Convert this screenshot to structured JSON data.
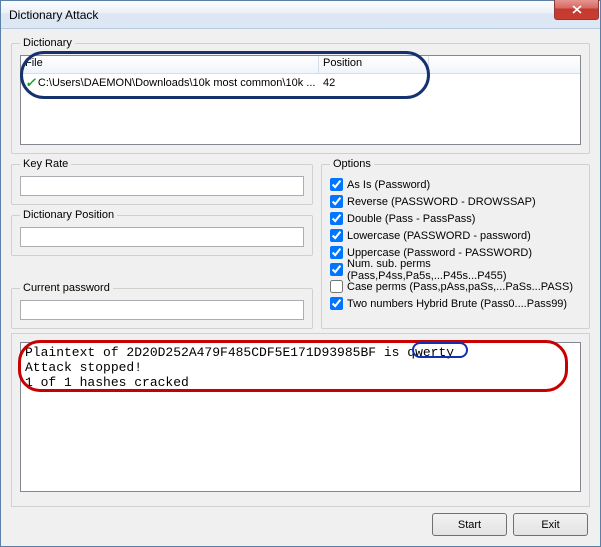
{
  "window": {
    "title": "Dictionary Attack"
  },
  "groups": {
    "dictionary": "Dictionary",
    "key_rate": "Key Rate",
    "dictionary_position": "Dictionary Position",
    "current_password": "Current password",
    "options": "Options"
  },
  "table": {
    "headers": {
      "file": "File",
      "position": "Position"
    },
    "rows": [
      {
        "file": "C:\\Users\\DAEMON\\Downloads\\10k most common\\10k ...",
        "position": "42"
      }
    ]
  },
  "fields": {
    "key_rate": "",
    "dictionary_position": "",
    "current_password": ""
  },
  "options": [
    {
      "label": "As Is (Password)",
      "checked": true
    },
    {
      "label": "Reverse (PASSWORD - DROWSSAP)",
      "checked": true
    },
    {
      "label": "Double (Pass - PassPass)",
      "checked": true
    },
    {
      "label": "Lowercase (PASSWORD - password)",
      "checked": true
    },
    {
      "label": "Uppercase (Password - PASSWORD)",
      "checked": true
    },
    {
      "label": "Num. sub. perms (Pass,P4ss,Pa5s,...P45s...P455)",
      "checked": true
    },
    {
      "label": "Case perms (Pass,pAss,paSs,...PaSs...PASS)",
      "checked": false
    },
    {
      "label": "Two numbers Hybrid Brute (Pass0....Pass99)",
      "checked": true
    }
  ],
  "output": {
    "line1_prefix": "Plaintext of 2D20D252A479F485CDF5E171D93985BF is ",
    "line1_result": "qwerty",
    "line2": "Attack stopped!",
    "line3": "1 of 1 hashes cracked"
  },
  "buttons": {
    "start": "Start",
    "exit": "Exit"
  }
}
